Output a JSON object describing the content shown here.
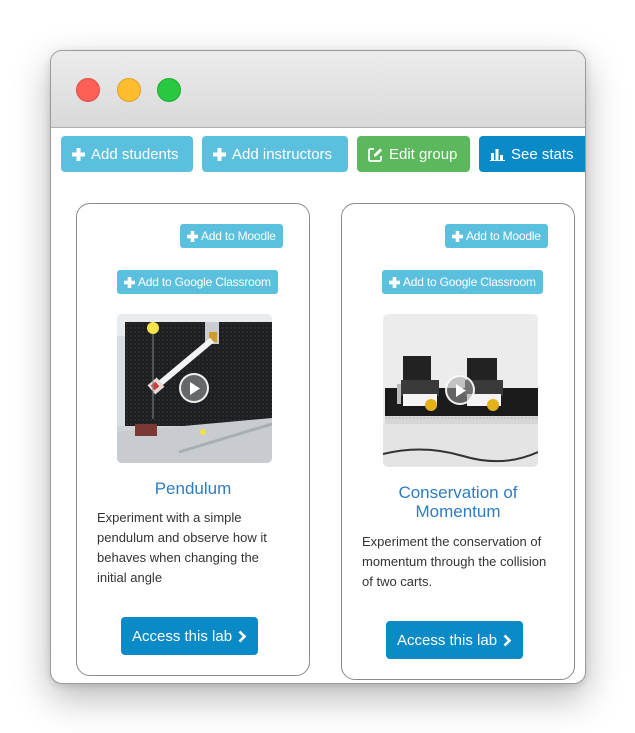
{
  "window": {
    "controls": [
      "close",
      "minimize",
      "maximize"
    ]
  },
  "toolbar": {
    "add_students": "Add students",
    "add_instructors": "Add instructors",
    "edit_group": "Edit group",
    "see_stats": "See stats"
  },
  "labs": [
    {
      "add_moodle": "Add to Moodle",
      "add_classroom": "Add to Google Classroom",
      "title": "Pendulum",
      "description": "Experiment with a simple pendulum and observe how it behaves when changing the initial angle",
      "access": "Access this lab",
      "thumbnail_icon": "play-icon"
    },
    {
      "add_moodle": "Add to Moodle",
      "add_classroom": "Add to Google Classroom",
      "title": "Conservation of Momentum",
      "description": "Experiment the conservation of momentum through the collision of two carts.",
      "access": "Access this lab",
      "thumbnail_icon": "play-icon"
    }
  ],
  "colors": {
    "info": "#5bc0de",
    "success": "#5cb85c",
    "primary": "#0a8bc8",
    "link": "#2f7cc1"
  }
}
